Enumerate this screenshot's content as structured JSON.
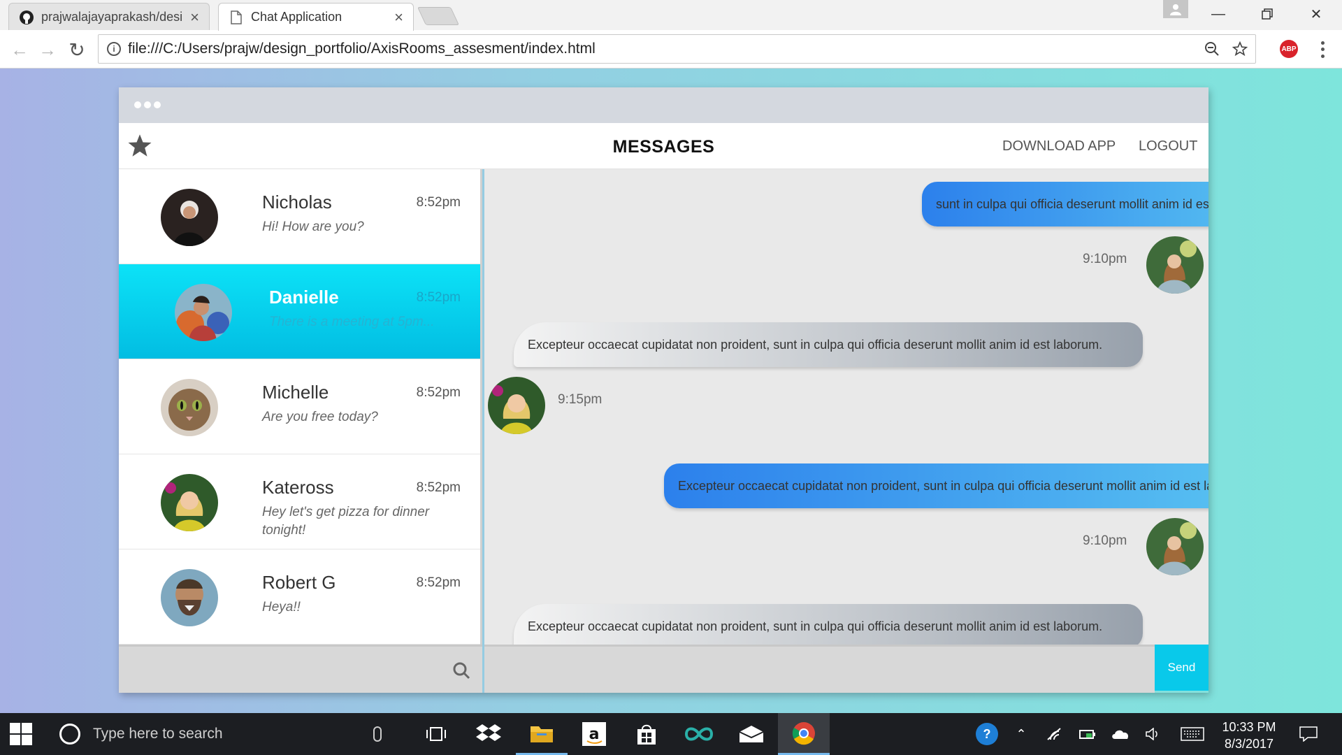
{
  "browser": {
    "tabs": [
      {
        "title": "prajwalajayaprakash/desi",
        "icon": "github-icon"
      },
      {
        "title": "Chat Application",
        "icon": "document-icon"
      }
    ],
    "url": "file:///C:/Users/prajw/design_portfolio/AxisRooms_assesment/index.html",
    "extension_label": "ABP"
  },
  "app": {
    "header": {
      "title": "MESSAGES",
      "download_label": "DOWNLOAD APP",
      "logout_label": "LOGOUT"
    },
    "contacts": [
      {
        "name": "Nicholas",
        "time": "8:52pm",
        "message": "Hi! How are you?",
        "active": false
      },
      {
        "name": "Danielle",
        "time": "8:52pm",
        "message": "There is a meeting at 5pm...",
        "active": true
      },
      {
        "name": "Michelle",
        "time": "8:52pm",
        "message": "Are you free today?",
        "active": false
      },
      {
        "name": "Kateross",
        "time": "8:52pm",
        "message": "Hey let's get pizza for dinner tonight!",
        "active": false
      },
      {
        "name": "Robert G",
        "time": "8:52pm",
        "message": "Heya!!",
        "active": false
      }
    ],
    "messages": [
      {
        "direction": "outgoing",
        "text": "sunt in culpa qui officia deserunt mollit anim id est laborum.",
        "time": "9:10pm"
      },
      {
        "direction": "incoming",
        "text": "Excepteur occaecat cupidatat non proident, sunt in culpa qui officia deserunt mollit anim id est laborum.",
        "time": "9:15pm"
      },
      {
        "direction": "outgoing",
        "text": "Excepteur occaecat cupidatat non proident, sunt in culpa qui officia deserunt mollit anim id est laborum.",
        "time": "9:10pm"
      },
      {
        "direction": "incoming",
        "text": "Excepteur occaecat cupidatat non proident, sunt in culpa qui officia deserunt mollit anim id est laborum.",
        "time": ""
      }
    ],
    "send_label": "Send",
    "colors": {
      "accent": "#09c9ea",
      "outgoing_bubble": "#2c80ec",
      "incoming_bubble": "#c0c5cb"
    }
  },
  "taskbar": {
    "search_placeholder": "Type here to search",
    "time": "10:33 PM",
    "date": "8/3/2017",
    "apps": [
      "task-view-icon",
      "dropbox-icon",
      "file-explorer-icon",
      "amazon-icon",
      "store-icon",
      "infinity-icon",
      "mail-icon",
      "chrome-icon"
    ]
  }
}
